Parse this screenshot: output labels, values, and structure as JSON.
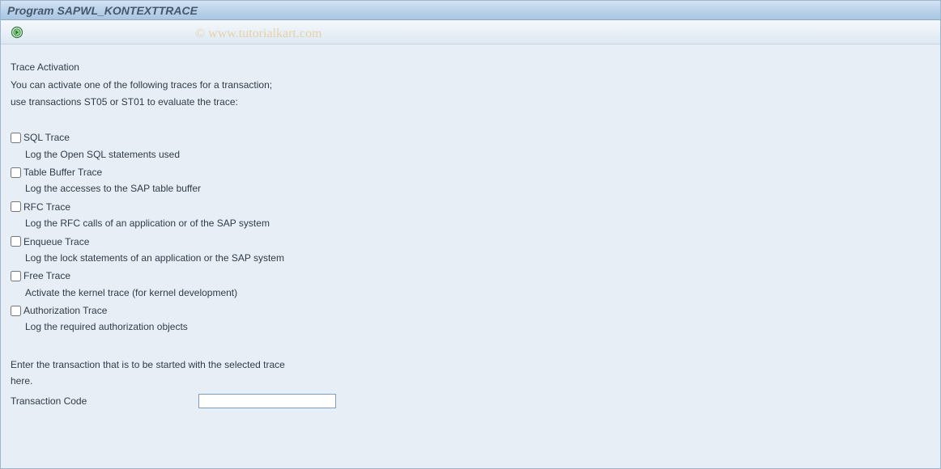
{
  "title": "Program SAPWL_KONTEXTTRACE",
  "watermark": "© www.tutorialkart.com",
  "toolbar": {
    "execute_tooltip": "Execute"
  },
  "section_heading": "Trace Activation",
  "intro_line1": "You can activate one of the following traces for a transaction;",
  "intro_line2": "use transactions ST05 or ST01 to evaluate the trace:",
  "traces": {
    "sql": {
      "label": "SQL Trace",
      "desc": "Log the Open SQL statements used"
    },
    "tbuf": {
      "label": "Table Buffer Trace",
      "desc": "Log the accesses to the SAP table buffer"
    },
    "rfc": {
      "label": "RFC Trace",
      "desc": "Log the RFC calls of an application or of the SAP system"
    },
    "enq": {
      "label": "Enqueue Trace",
      "desc": "Log the lock statements of an application or the SAP system"
    },
    "free": {
      "label": "Free Trace",
      "desc": "Activate the kernel trace (for kernel development)"
    },
    "auth": {
      "label": "Authorization Trace",
      "desc": "Log the required authorization objects"
    }
  },
  "footer_line1": "Enter the transaction that is to be started with the selected trace",
  "footer_line2": "here.",
  "tcode_label": "Transaction Code",
  "tcode_value": ""
}
